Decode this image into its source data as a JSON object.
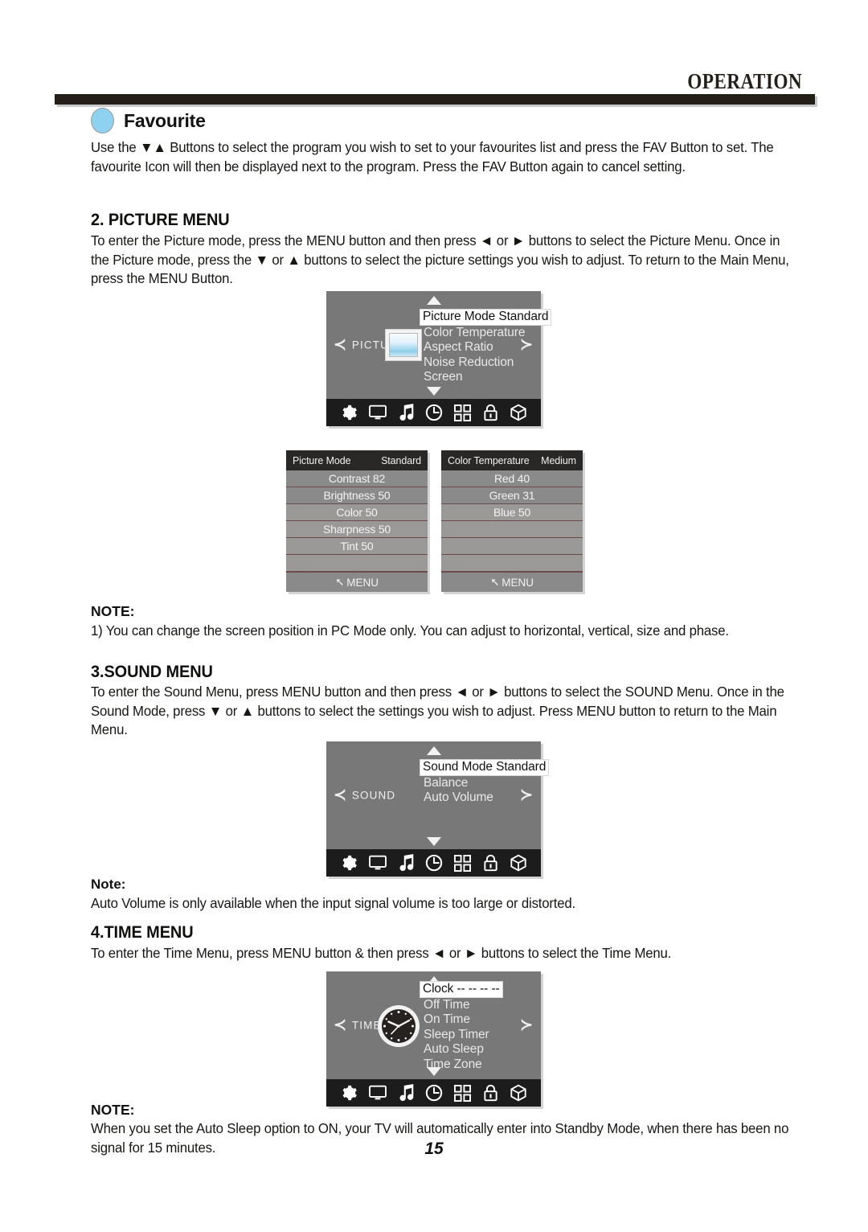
{
  "header": {
    "title": "OPERATION"
  },
  "favourite": {
    "heading": "Favourite",
    "body": "Use the ▼▲  Buttons to select the program you wish to set to your favourites list and press the FAV Button to set. The favourite Icon will then be displayed next to the program. Press the FAV Button again to cancel setting."
  },
  "picture_menu": {
    "heading": "2. PICTURE MENU",
    "body": "To enter the Picture mode, press the MENU button and then press ◄ or ► buttons to select the Picture Menu. Once in the Picture mode, press the ▼ or ▲ buttons to select the picture settings you wish to adjust. To return to the Main Menu, press the MENU Button.",
    "osd": {
      "side_label": "PICTURE",
      "left_arrow": "≺",
      "right_arrow": "≻",
      "items": [
        {
          "label": "Picture Mode Standard",
          "selected": true
        },
        {
          "label": "Color Temperature",
          "selected": false
        },
        {
          "label": "Aspect Ratio",
          "selected": false
        },
        {
          "label": "Noise Reduction",
          "selected": false
        },
        {
          "label": "Screen",
          "selected": false
        }
      ],
      "icons": [
        "gear-icon",
        "monitor-icon",
        "music-note-icon",
        "clock-icon",
        "grid-icon",
        "lock-icon",
        "cube-icon"
      ]
    },
    "submenu_left": {
      "title": "Picture Mode",
      "value": "Standard",
      "rows": [
        "Contrast 82",
        "Brightness 50",
        "Color 50",
        "Sharpness 50",
        "Tint 50",
        ""
      ],
      "footer": "MENU"
    },
    "submenu_right": {
      "title": "Color Temperature",
      "value": "Medium",
      "rows": [
        "Red 40",
        "Green 31",
        "Blue 50",
        "",
        "",
        ""
      ],
      "footer": "MENU"
    },
    "note_label": "NOTE:",
    "note_body": "1) You can change the screen position in PC Mode only. You can adjust to horizontal, vertical, size and phase."
  },
  "sound_menu": {
    "heading": "3.SOUND MENU",
    "body": "To enter the Sound Menu, press MENU button and then press ◄ or ► buttons to select the SOUND Menu. Once in the Sound Mode,  press ▼ or ▲ buttons to select the settings you wish to adjust. Press MENU button to return to the Main Menu.",
    "osd": {
      "side_label": "SOUND",
      "left_arrow": "≺",
      "right_arrow": "≻",
      "items": [
        {
          "label": "Sound Mode Standard",
          "selected": true
        },
        {
          "label": "Balance",
          "selected": false
        },
        {
          "label": "Auto Volume",
          "selected": false
        }
      ],
      "icons": [
        "gear-icon",
        "monitor-icon",
        "music-note-icon",
        "clock-icon",
        "grid-icon",
        "lock-icon",
        "cube-icon"
      ]
    },
    "note_label": "Note:",
    "note_body": "Auto Volume is only available when the  input signal volume is too large  or distorted."
  },
  "time_menu": {
    "heading": "4.TIME MENU",
    "body": "To enter the Time Menu, press MENU button & then press ◄ or ► buttons to select the Time Menu.",
    "osd": {
      "side_label": "TIME",
      "left_arrow": "≺",
      "right_arrow": "≻",
      "items": [
        {
          "label": "Clock --    --    --    --",
          "selected": true
        },
        {
          "label": "Off Time",
          "selected": false
        },
        {
          "label": "On Time",
          "selected": false
        },
        {
          "label": "Sleep Timer",
          "selected": false
        },
        {
          "label": "Auto Sleep",
          "selected": false
        },
        {
          "label": "Time Zone",
          "selected": false
        }
      ],
      "icons": [
        "gear-icon",
        "monitor-icon",
        "music-note-icon",
        "clock-icon",
        "grid-icon",
        "lock-icon",
        "cube-icon"
      ]
    },
    "note_label": "NOTE:",
    "note_body": "When you set the Auto Sleep option to ON, your TV will automatically enter into Standby Mode, when there has been no signal for 15 minutes."
  },
  "page_number": "15"
}
